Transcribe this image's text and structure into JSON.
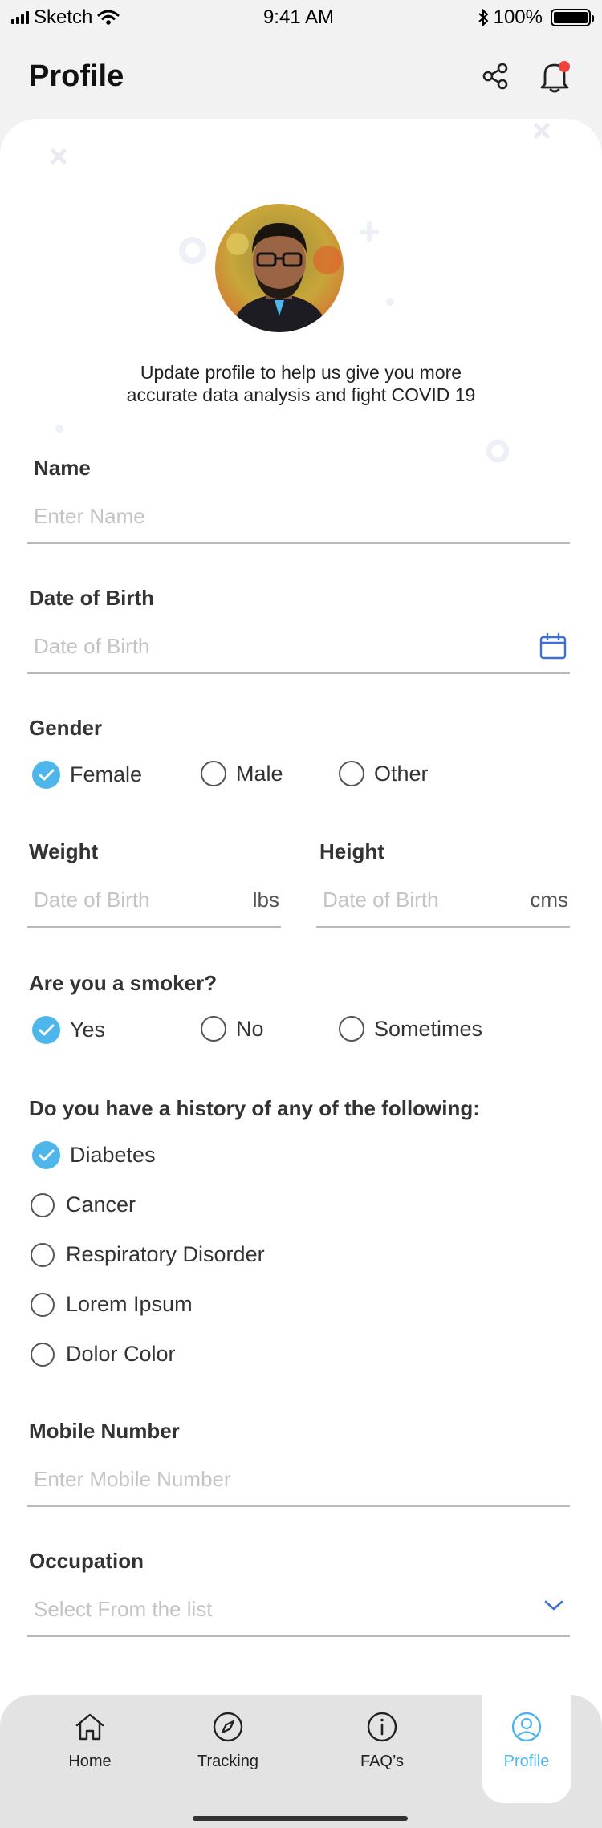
{
  "status_bar": {
    "carrier": "Sketch",
    "time": "9:41 AM",
    "battery": "100%"
  },
  "header": {
    "title": "Profile",
    "share_icon": "share-icon",
    "bell_icon": "bell-icon"
  },
  "intro_text_line1": "Update profile to help us give you more",
  "intro_text_line2": "accurate data analysis and fight COVID 19",
  "form": {
    "name": {
      "label": "Name",
      "placeholder": "Enter Name",
      "value": ""
    },
    "dob": {
      "label": "Date of Birth",
      "placeholder": "Date of Birth",
      "value": ""
    },
    "gender": {
      "label": "Gender",
      "options": [
        "Female",
        "Male",
        "Other"
      ],
      "selected": "Female"
    },
    "weight": {
      "label": "Weight",
      "placeholder": "Date of Birth",
      "unit": "lbs"
    },
    "height": {
      "label": "Height",
      "placeholder": "Date of Birth",
      "unit": "cms"
    },
    "smoker": {
      "label": "Are you a smoker?",
      "options": [
        "Yes",
        "No",
        "Sometimes"
      ],
      "selected": "Yes"
    },
    "history": {
      "label": "Do you have a history of any of the following:",
      "options": [
        "Diabetes",
        "Cancer",
        "Respiratory Disorder",
        "Lorem Ipsum",
        "Dolor Color"
      ],
      "checked": [
        "Diabetes"
      ]
    },
    "mobile": {
      "label": "Mobile Number",
      "placeholder": "Enter Mobile Number",
      "value": ""
    },
    "occupation": {
      "label": "Occupation",
      "placeholder": "Select From the list"
    }
  },
  "nav": {
    "items": [
      {
        "label": "Home",
        "icon": "home-icon"
      },
      {
        "label": "Tracking",
        "icon": "compass-icon"
      },
      {
        "label": "FAQ’s",
        "icon": "info-icon"
      },
      {
        "label": "Profile",
        "icon": "user-icon"
      }
    ],
    "active": "Profile"
  },
  "colors": {
    "accent": "#4fb6ec",
    "notification": "#f0413b",
    "calendar_icon": "#3d6fd9"
  }
}
